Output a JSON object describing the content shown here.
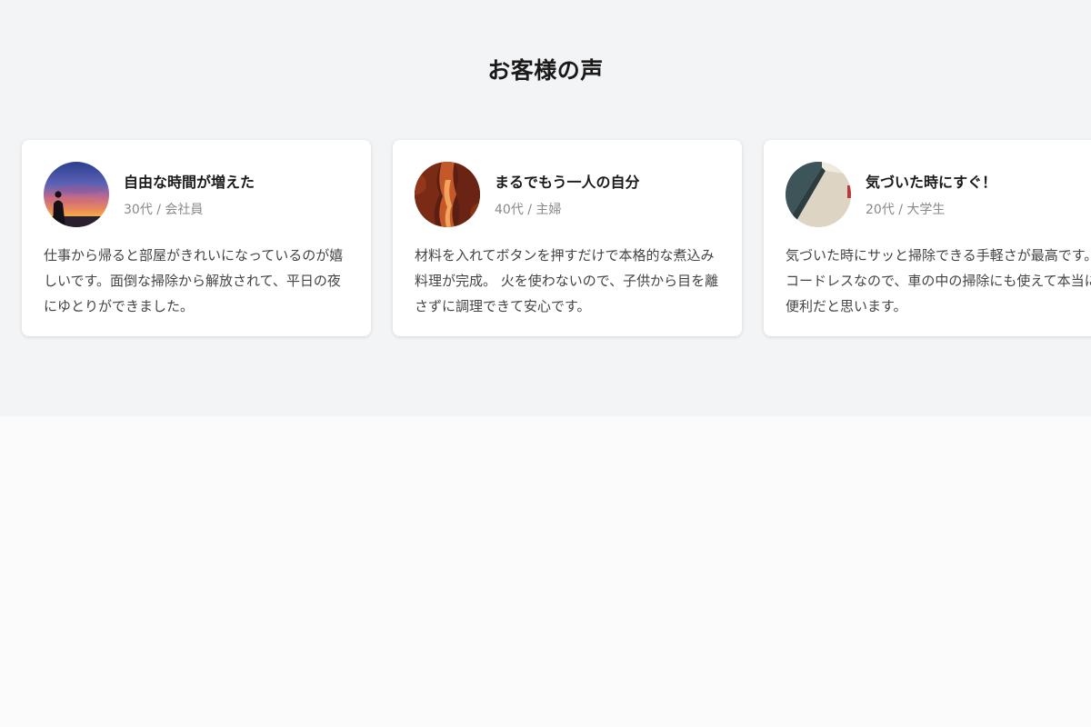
{
  "section": {
    "title": "お客様の声",
    "background": "#f3f4f6"
  },
  "testimonials": [
    {
      "name": "自由な時間が増えた",
      "meta": "30代 / 会社員",
      "text": "仕事から帰ると部屋がきれいになっているのが嬉しいです。面倒な掃除から解放されて、平日の夜にゆとりができました。",
      "avatar_icon": "sunset-silhouette-photo"
    },
    {
      "name": "まるでもう一人の自分",
      "meta": "40代 / 主婦",
      "text": "材料を入れてボタンを押すだけで本格的な煮込み料理が完成。 火を使わないので、子供から目を離さずに調理できて安心です。",
      "avatar_icon": "canyon-photo"
    },
    {
      "name": "気づいた時にすぐ！",
      "meta": "20代 / 大学生",
      "text": "気づいた時にサッと掃除できる手軽さが最高です。 コードレスなので、車の中の掃除にも使えて本当に便利だと思います。",
      "avatar_icon": "wall-corner-photo"
    }
  ]
}
